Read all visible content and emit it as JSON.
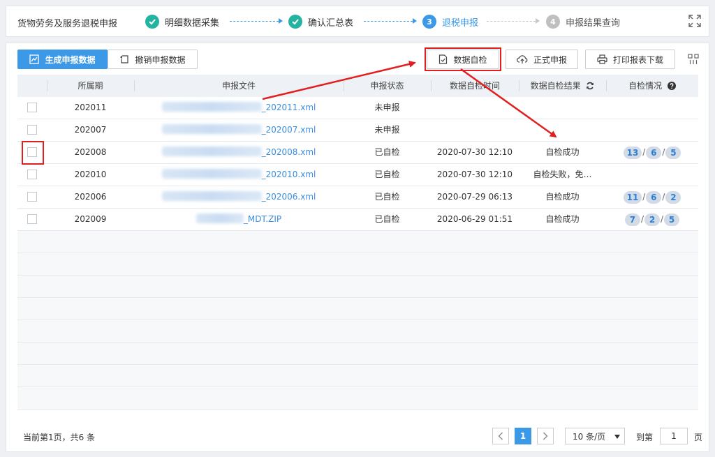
{
  "header": {
    "title": "货物劳务及服务退税申报",
    "steps": [
      {
        "num": "1",
        "label": "明细数据采集",
        "state": "done"
      },
      {
        "num": "2",
        "label": "确认汇总表",
        "state": "done"
      },
      {
        "num": "3",
        "label": "退税申报",
        "state": "current"
      },
      {
        "num": "4",
        "label": "申报结果查询",
        "state": "todo"
      }
    ]
  },
  "toolbar": {
    "generate_label": "生成申报数据",
    "revoke_label": "撤销申报数据",
    "selfcheck_label": "数据自检",
    "submit_label": "正式申报",
    "print_label": "打印报表下载"
  },
  "table": {
    "headers": [
      "所属期",
      "申报文件",
      "申报状态",
      "数据自检时间",
      "数据自检结果",
      "自检情况"
    ],
    "rows": [
      {
        "period": "202011",
        "file_suffix": "_202011.xml",
        "status": "未申报",
        "time": "",
        "result": "",
        "counts": []
      },
      {
        "period": "202007",
        "file_suffix": "_202007.xml",
        "status": "未申报",
        "time": "",
        "result": "",
        "counts": []
      },
      {
        "period": "202008",
        "file_suffix": "_202008.xml",
        "status": "已自检",
        "time": "2020-07-30 12:10",
        "result": "自检成功",
        "counts": [
          "13",
          "6",
          "5"
        ]
      },
      {
        "period": "202010",
        "file_suffix": "_202010.xml",
        "status": "已自检",
        "time": "2020-07-30 12:10",
        "result": "自检失败，免…",
        "counts": []
      },
      {
        "period": "202006",
        "file_suffix": "_202006.xml",
        "status": "已自检",
        "time": "2020-07-29 06:13",
        "result": "自检成功",
        "counts": [
          "11",
          "6",
          "2"
        ]
      },
      {
        "period": "202009",
        "file_suffix": "_MDT.ZIP",
        "status": "已自检",
        "time": "2020-06-29 01:51",
        "result": "自检成功",
        "counts": [
          "7",
          "2",
          "5"
        ]
      }
    ]
  },
  "footer": {
    "summary": "当前第1页，共6 条",
    "current_page": "1",
    "page_size": "10 条/页",
    "goto_prefix": "到第",
    "goto_value": "1",
    "goto_suffix": "页"
  },
  "colors": {
    "primary": "#3b99e8",
    "done": "#22b4a0",
    "annotation": "#e02020"
  }
}
